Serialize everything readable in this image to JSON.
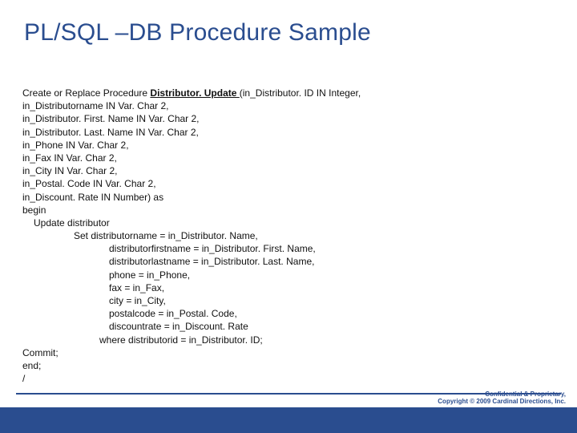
{
  "title": "PL/SQL –DB Procedure Sample",
  "proc": {
    "prefix": "Create or Replace Procedure ",
    "name": "Distributor. Update ",
    "suffix": "(in_Distributor. ID IN Integer,"
  },
  "lines": {
    "l2": "in_Distributorname IN Var. Char 2,",
    "l3": "in_Distributor. First. Name IN Var. Char 2,",
    "l4": "in_Distributor. Last. Name IN Var. Char 2,",
    "l5": "in_Phone IN Var. Char 2,",
    "l6": "in_Fax IN Var. Char 2,",
    "l7": "in_City IN Var. Char 2,",
    "l8": "in_Postal. Code IN Var. Char 2,",
    "l9": "in_Discount. Rate IN Number) as",
    "l10": "begin",
    "l11": "Update distributor",
    "l12": "Set distributorname = in_Distributor. Name,",
    "l13": "distributorfirstname = in_Distributor. First. Name,",
    "l14": "distributorlastname = in_Distributor. Last. Name,",
    "l15": "phone = in_Phone,",
    "l16": "fax = in_Fax,",
    "l17": "city = in_City,",
    "l18": "postalcode = in_Postal. Code,",
    "l19": "discountrate = in_Discount. Rate",
    "l20": "where distributorid = in_Distributor. ID;",
    "l21": "Commit;",
    "l22": "end;",
    "l23": "/"
  },
  "footer": {
    "l1": "Confidential & Proprietary,",
    "l2": "Copyright © 2009 Cardinal Directions, Inc."
  }
}
